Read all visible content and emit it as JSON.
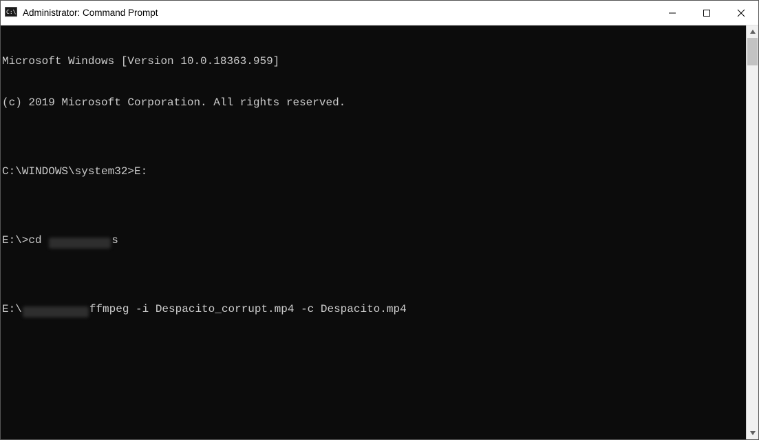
{
  "window": {
    "title": "Administrator: Command Prompt"
  },
  "terminal": {
    "line1": "Microsoft Windows [Version 10.0.18363.959]",
    "line2": "(c) 2019 Microsoft Corporation. All rights reserved.",
    "blank1": "",
    "line3": "C:\\WINDOWS\\system32>E:",
    "blank2": "",
    "line4_pre": "E:\\>cd ",
    "line4_post": "s",
    "blank3": "",
    "line5_pre": "E:\\",
    "line5_post": "ffmpeg -i Despacito_corrupt.mp4 -c Despacito.mp4"
  }
}
